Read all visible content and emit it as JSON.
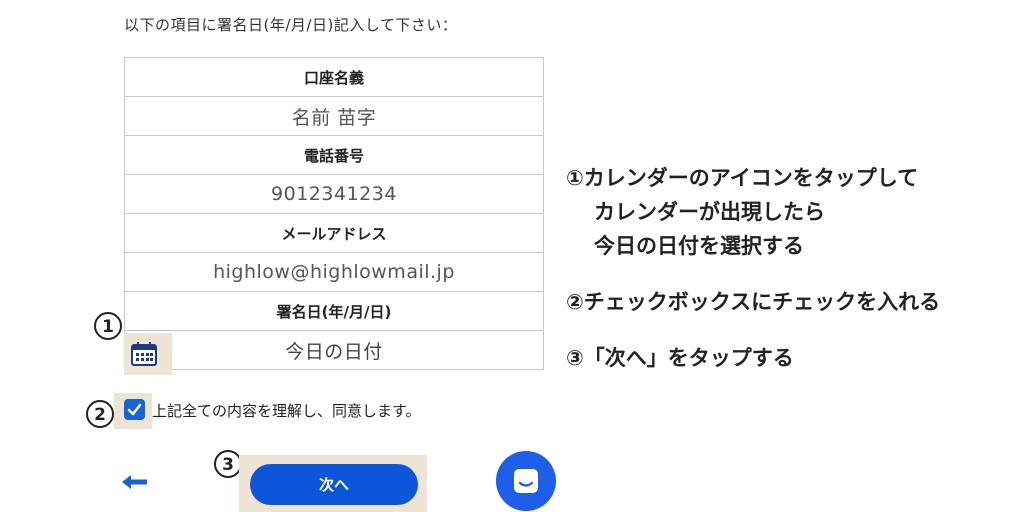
{
  "instruction": "以下の項目に署名日(年/月/日)記入して下さい：",
  "table": {
    "account_name_label": "口座名義",
    "account_name_value": "名前 苗字",
    "phone_label": "電話番号",
    "phone_value": "9012341234",
    "email_label": "メールアドレス",
    "email_value": "highlow@highlowmail.jp",
    "sign_date_label": "署名日(年/月/日)",
    "sign_date_placeholder": "今日の日付"
  },
  "markers": {
    "m1": "1",
    "m2": "2",
    "m3": "3"
  },
  "agree_text": "上記全ての内容を理解し、同意します。",
  "next_label": "次へ",
  "steps": {
    "step1_line1": "①カレンダーのアイコンをタップして",
    "step1_line2": "カレンダーが出現したら",
    "step1_line3": "今日の日付を選択する",
    "step2": "②チェックボックスにチェックを入れる",
    "step3": "③「次へ」をタップする"
  },
  "colors": {
    "accent": "#0d55d9",
    "highlight": "#ede4d3",
    "checkbox": "#1565d8"
  },
  "icons": {
    "calendar": "calendar-icon",
    "check": "check-icon",
    "back": "arrow-left-icon",
    "chat": "chat-icon"
  }
}
